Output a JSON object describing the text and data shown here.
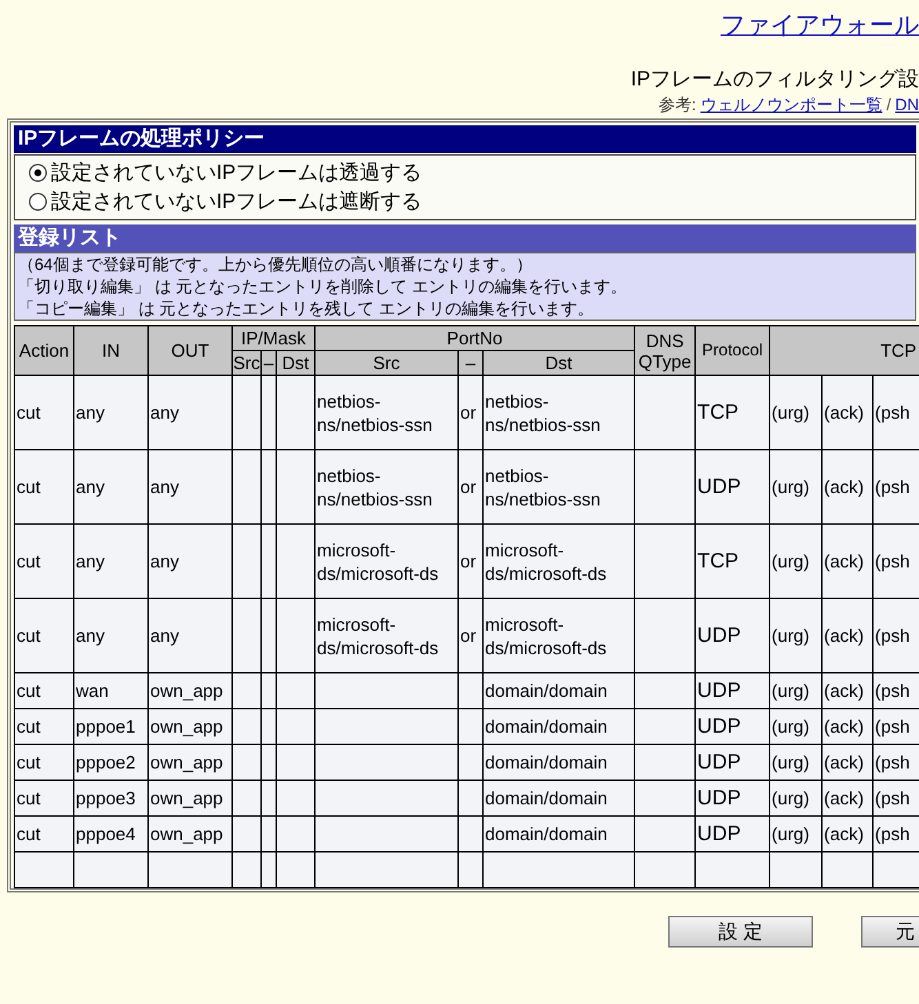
{
  "page_title": "ファイアウォール",
  "subtitle": "IPフレームのフィルタリング設",
  "reference": {
    "label": "参考:",
    "links": [
      "ウェルノウンポート一覧",
      "DN"
    ],
    "separator": "/"
  },
  "policy": {
    "heading": "IPフレームの処理ポリシー",
    "options": [
      {
        "label": "設定されていないIPフレームは透過する",
        "selected": true
      },
      {
        "label": "設定されていないIPフレームは遮断する",
        "selected": false
      }
    ]
  },
  "list": {
    "heading": "登録リスト",
    "notes": [
      "（64個まで登録可能です。上から優先順位の高い順番になります。）",
      "「切り取り編集」 は 元となったエントリを削除して エントリの編集を行います。",
      "「コピー編集」 は 元となったエントリを残して エントリの編集を行います。"
    ]
  },
  "table": {
    "header": {
      "action": "Action",
      "in": "IN",
      "out": "OUT",
      "ip_mask": "IP/Mask",
      "ip_src": "Src",
      "ip_sep": "–",
      "ip_dst": "Dst",
      "port": "PortNo",
      "port_src": "Src",
      "port_sep": "–",
      "port_dst": "Dst",
      "dns": "DNS QType",
      "protocol": "Protocol",
      "tcp": "TCP"
    },
    "rows": [
      {
        "action": "cut",
        "in": "any",
        "out": "any",
        "port_src": "netbios-ns/netbios-ssn",
        "port_sep": "or",
        "port_dst": "netbios-ns/netbios-ssn",
        "protocol": "TCP",
        "tcp_flags": [
          "(urg)",
          "(ack)",
          "(psh"
        ]
      },
      {
        "action": "cut",
        "in": "any",
        "out": "any",
        "port_src": "netbios-ns/netbios-ssn",
        "port_sep": "or",
        "port_dst": "netbios-ns/netbios-ssn",
        "protocol": "UDP",
        "tcp_flags": [
          "(urg)",
          "(ack)",
          "(psh"
        ]
      },
      {
        "action": "cut",
        "in": "any",
        "out": "any",
        "port_src": "microsoft-ds/microsoft-ds",
        "port_sep": "or",
        "port_dst": "microsoft-ds/microsoft-ds",
        "protocol": "TCP",
        "tcp_flags": [
          "(urg)",
          "(ack)",
          "(psh"
        ]
      },
      {
        "action": "cut",
        "in": "any",
        "out": "any",
        "port_src": "microsoft-ds/microsoft-ds",
        "port_sep": "or",
        "port_dst": "microsoft-ds/microsoft-ds",
        "protocol": "UDP",
        "tcp_flags": [
          "(urg)",
          "(ack)",
          "(psh"
        ]
      },
      {
        "action": "cut",
        "in": "wan",
        "out": "own_app",
        "port_dst": "domain/domain",
        "protocol": "UDP",
        "tcp_flags": [
          "(urg)",
          "(ack)",
          "(psh"
        ]
      },
      {
        "action": "cut",
        "in": "pppoe1",
        "out": "own_app",
        "port_dst": "domain/domain",
        "protocol": "UDP",
        "tcp_flags": [
          "(urg)",
          "(ack)",
          "(psh"
        ]
      },
      {
        "action": "cut",
        "in": "pppoe2",
        "out": "own_app",
        "port_dst": "domain/domain",
        "protocol": "UDP",
        "tcp_flags": [
          "(urg)",
          "(ack)",
          "(psh"
        ]
      },
      {
        "action": "cut",
        "in": "pppoe3",
        "out": "own_app",
        "port_dst": "domain/domain",
        "protocol": "UDP",
        "tcp_flags": [
          "(urg)",
          "(ack)",
          "(psh"
        ]
      },
      {
        "action": "cut",
        "in": "pppoe4",
        "out": "own_app",
        "port_dst": "domain/domain",
        "protocol": "UDP",
        "tcp_flags": [
          "(urg)",
          "(ack)",
          "(psh"
        ]
      }
    ]
  },
  "buttons": [
    "設 定",
    "元"
  ]
}
